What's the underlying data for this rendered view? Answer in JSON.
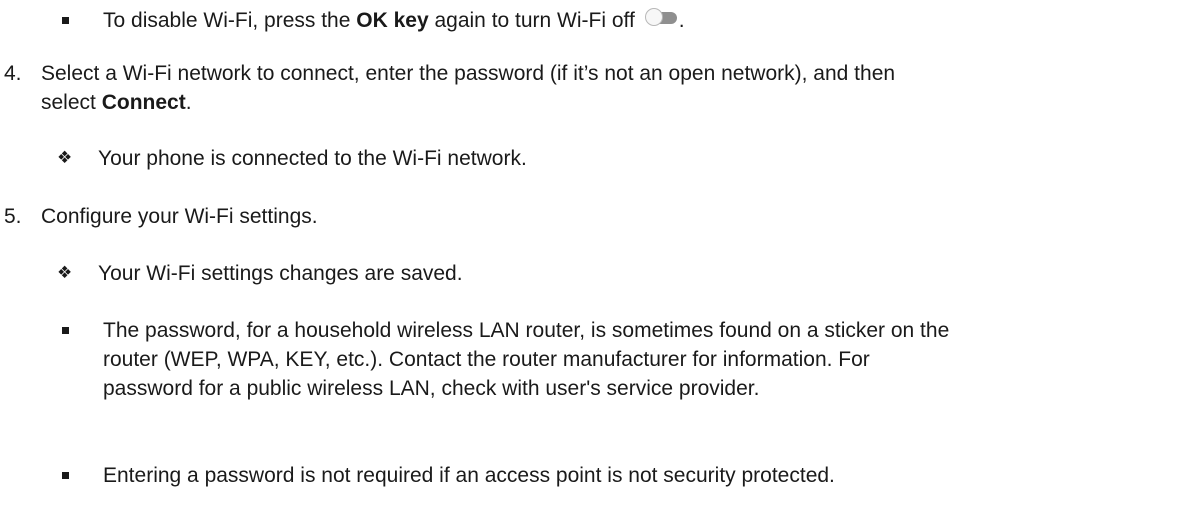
{
  "bullet1": {
    "before": "To disable Wi-Fi, press the ",
    "bold": "OK key",
    "after": " again to turn Wi-Fi off",
    "trailing": "."
  },
  "step4": {
    "number": "4.",
    "line1": "Select a Wi-Fi network to connect, enter the password (if it’s not an open network), and then",
    "line2_before": "select ",
    "line2_bold": "Connect",
    "line2_after": "."
  },
  "result4": "Your phone is connected to the Wi-Fi network.",
  "step5": {
    "number": "5.",
    "text": "Configure your Wi-Fi settings."
  },
  "result5": "Your Wi-Fi settings changes are saved.",
  "note1": {
    "line1": "The password, for a household wireless LAN router, is sometimes found on a sticker on the",
    "line2": "router (WEP, WPA, KEY, etc.). Contact the router manufacturer for information. For",
    "line3": "password for a public wireless LAN, check with user's service provider."
  },
  "note2": "Entering a password is not required if an access point is not security protected.",
  "glyphs": {
    "diamond": "❖"
  },
  "toggle_state": "off"
}
